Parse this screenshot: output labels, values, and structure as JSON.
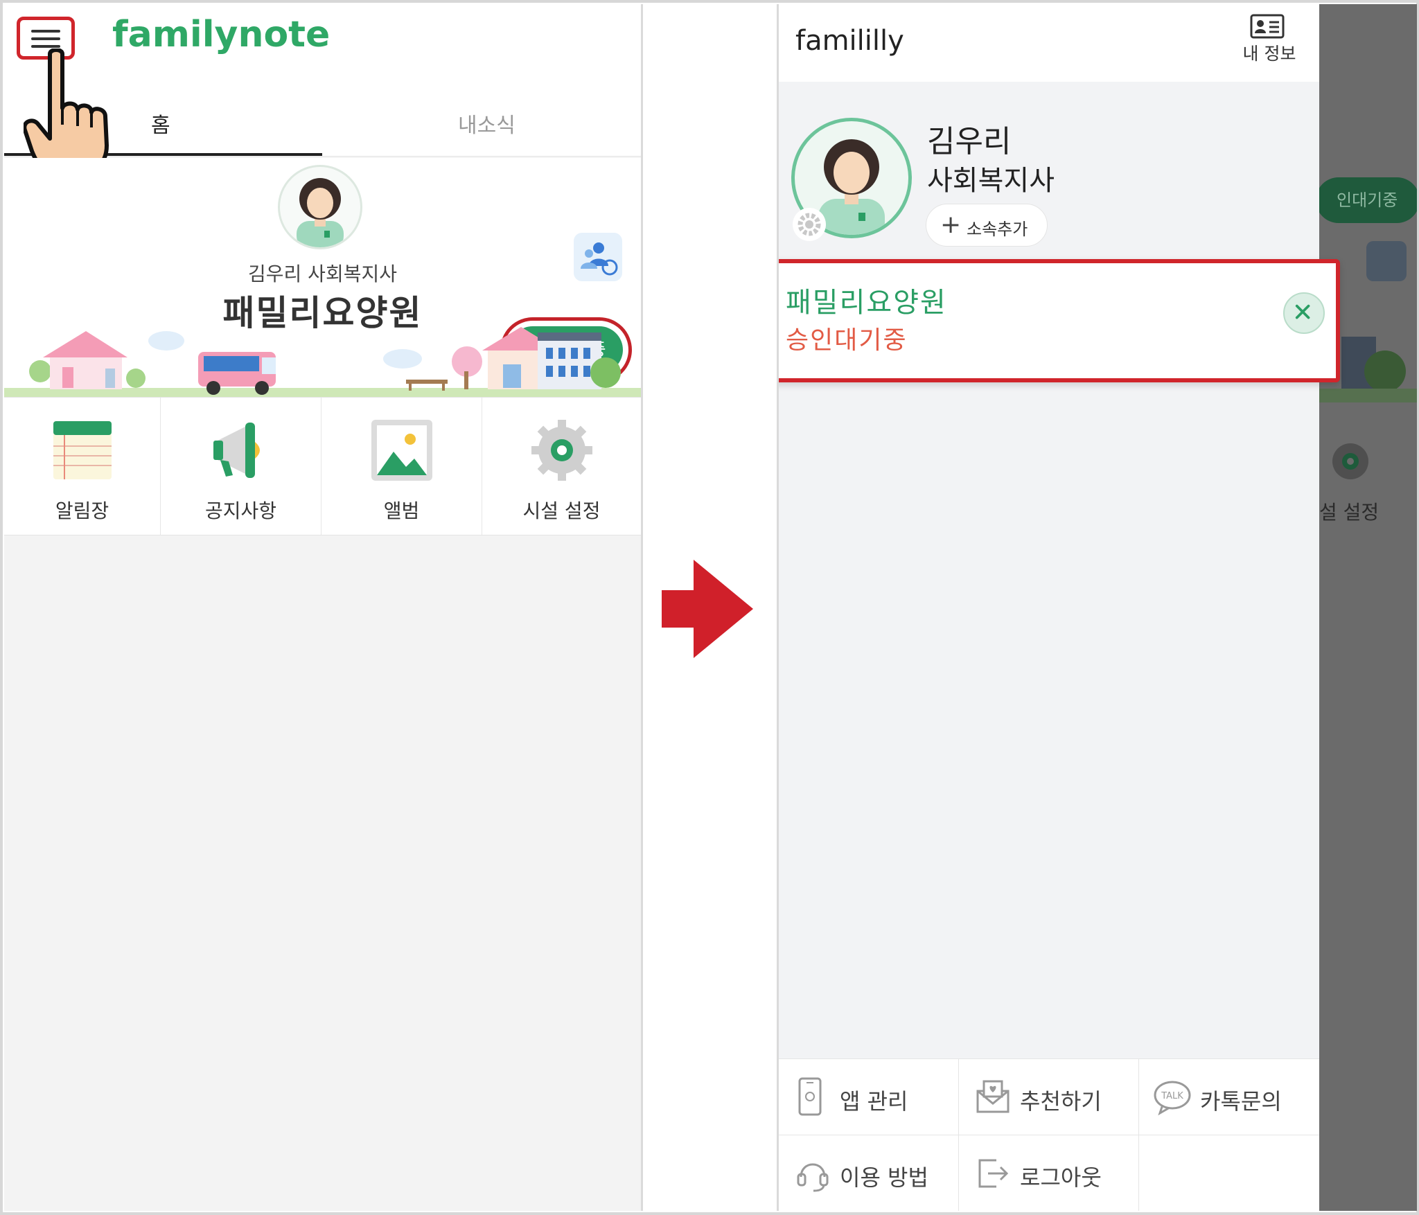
{
  "left_screen": {
    "app_logo": "familynote",
    "tabs": [
      {
        "label": "홈",
        "active": true
      },
      {
        "label": "내소식",
        "active": false
      }
    ],
    "approval_badge": "승인대기중",
    "user_line": "김우리 사회복지사",
    "facility_name": "패밀리요양원",
    "menu": [
      {
        "label": "알림장",
        "icon": "notebook-icon"
      },
      {
        "label": "공지사항",
        "icon": "megaphone-icon"
      },
      {
        "label": "앨범",
        "icon": "album-icon"
      },
      {
        "label": "시설 설정",
        "icon": "gear-icon"
      }
    ]
  },
  "right_screen": {
    "brand": "famililly",
    "my_info_label": "내 정보",
    "profile": {
      "name": "김우리",
      "role": "사회복지사",
      "add_affiliation": "소속추가"
    },
    "facility_card": {
      "name": "패밀리요양원",
      "status": "승인대기중"
    },
    "bottom_menu": [
      {
        "label": "앱 관리",
        "icon": "phone-icon"
      },
      {
        "label": "추천하기",
        "icon": "envelope-icon"
      },
      {
        "label": "카톡문의",
        "icon": "talk-icon"
      },
      {
        "label": "이용 방법",
        "icon": "headset-icon"
      },
      {
        "label": "로그아웃",
        "icon": "logout-icon"
      }
    ],
    "background_glimpse": {
      "badge": "인대기중",
      "menu_label": "설 설정"
    }
  },
  "colors": {
    "brand_green": "#2fa866",
    "highlight_red": "#d0252b",
    "status_orange": "#e25b45"
  }
}
